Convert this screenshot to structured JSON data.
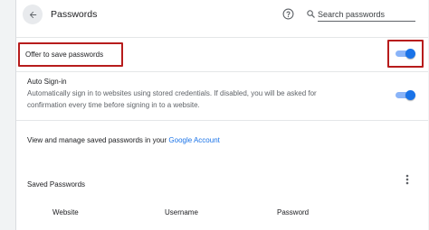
{
  "header": {
    "title": "Passwords",
    "search_placeholder": "Search passwords"
  },
  "offer_to_save": {
    "label": "Offer to save passwords",
    "enabled": true
  },
  "auto_signin": {
    "label": "Auto Sign-in",
    "description_line1": "Automatically sign in to websites using stored credentials. If disabled, you will be asked for",
    "description_line2": "confirmation every time before signing in to a website.",
    "enabled": true
  },
  "manage": {
    "text": "View and manage saved passwords in your ",
    "link": "Google Account"
  },
  "saved": {
    "title": "Saved Passwords",
    "columns": [
      "Website",
      "Username",
      "Password"
    ]
  },
  "colors": {
    "accent": "#1a73e8",
    "highlight": "#b71c1c"
  },
  "icons": {
    "back": "arrow-back-icon",
    "help": "help-circle-icon",
    "search": "search-icon",
    "more": "more-vert-icon"
  }
}
